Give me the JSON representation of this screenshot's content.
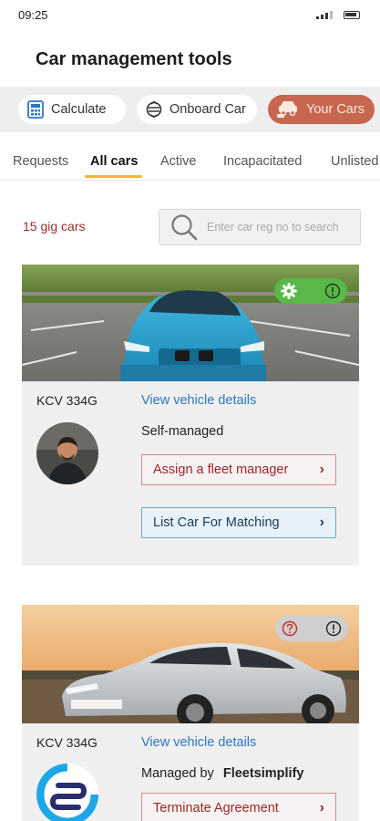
{
  "status_bar": {
    "time": "09:25"
  },
  "header": {
    "title": "Car management tools"
  },
  "toolbar": {
    "calculate_label": "Calculate",
    "onboard_label": "Onboard Car",
    "your_cars_label": "Your Cars"
  },
  "tabs": [
    {
      "label": "Requests",
      "active": false
    },
    {
      "label": "All cars",
      "active": true
    },
    {
      "label": "Active",
      "active": false
    },
    {
      "label": "Incapacitated",
      "active": false
    },
    {
      "label": "Unlisted",
      "active": false
    }
  ],
  "summary": {
    "count_text": "15 gig cars"
  },
  "search": {
    "placeholder": "Enter car reg no to search",
    "value": ""
  },
  "cars": [
    {
      "reg": "KCV 334G",
      "view_link": "View vehicle details",
      "status": "Self-managed",
      "actions": [
        "Assign a fleet manager",
        "List Car For Matching"
      ],
      "badge_color": "#58b848"
    },
    {
      "reg": "KCV 334G",
      "view_link": "View vehicle details",
      "managed_prefix": "Managed by",
      "manager": "Fleetsimplify",
      "actions": [
        "Terminate Agreement"
      ],
      "badge_color": "#cfcfcf"
    }
  ],
  "colors": {
    "accent": "#c8674f",
    "count": "#a02c2c",
    "link": "#2b76c6",
    "tab_underline": "#f2b53a"
  },
  "icons": [
    "calculator-icon",
    "onboard-car-icon",
    "your-cars-icon",
    "search-icon",
    "gear-icon",
    "info-icon",
    "help-icon",
    "chevron-right-icon"
  ]
}
